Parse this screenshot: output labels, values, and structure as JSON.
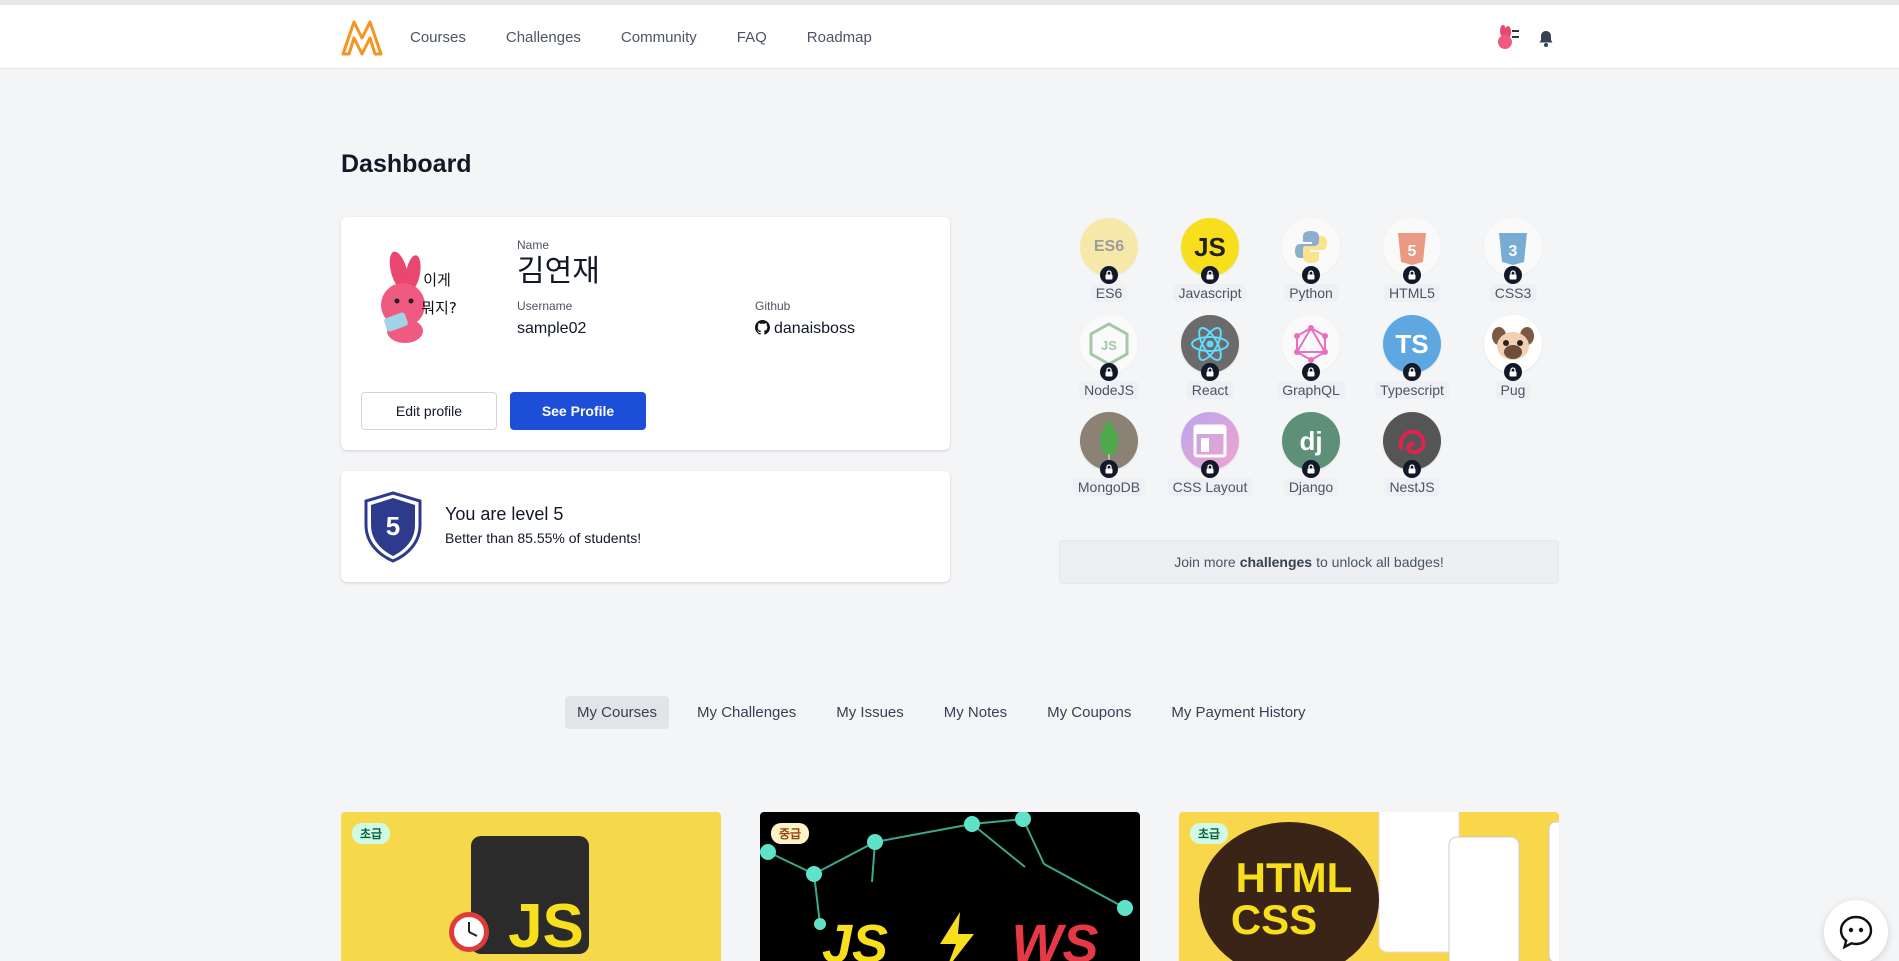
{
  "nav": {
    "links": [
      "Courses",
      "Challenges",
      "Community",
      "FAQ",
      "Roadmap"
    ],
    "brand_color": "#f7931e"
  },
  "dashboard": {
    "title": "Dashboard",
    "profile": {
      "name_label": "Name",
      "name": "김연재",
      "username_label": "Username",
      "username": "sample02",
      "github_label": "Github",
      "github": "danaisboss",
      "edit_button": "Edit profile",
      "see_button": "See Profile",
      "avatar_text_line1": "이게",
      "avatar_text_line2": "뭐지?"
    },
    "level": {
      "number": "5",
      "title": "You are level 5",
      "subtitle": "Better than 85.55% of students!"
    }
  },
  "badges": {
    "items": [
      {
        "label": "ES6",
        "icon": "es6-icon",
        "glyph": "ES6"
      },
      {
        "label": "Javascript",
        "icon": "javascript-icon",
        "glyph": "JS"
      },
      {
        "label": "Python",
        "icon": "python-icon",
        "glyph": ""
      },
      {
        "label": "HTML5",
        "icon": "html5-icon",
        "glyph": "5"
      },
      {
        "label": "CSS3",
        "icon": "css3-icon",
        "glyph": "3"
      },
      {
        "label": "NodeJS",
        "icon": "nodejs-icon",
        "glyph": "JS"
      },
      {
        "label": "React",
        "icon": "react-icon",
        "glyph": ""
      },
      {
        "label": "GraphQL",
        "icon": "graphql-icon",
        "glyph": ""
      },
      {
        "label": "Typescript",
        "icon": "typescript-icon",
        "glyph": "TS"
      },
      {
        "label": "Pug",
        "icon": "pug-icon",
        "glyph": ""
      },
      {
        "label": "MongoDB",
        "icon": "mongodb-icon",
        "glyph": ""
      },
      {
        "label": "CSS Layout",
        "icon": "css-layout-icon",
        "glyph": ""
      },
      {
        "label": "Django",
        "icon": "django-icon",
        "glyph": "dj"
      },
      {
        "label": "NestJS",
        "icon": "nestjs-icon",
        "glyph": ""
      }
    ],
    "unlock_prefix": "Join more",
    "unlock_bold": "challenges",
    "unlock_suffix": "to unlock all badges!"
  },
  "tabs": [
    "My Courses",
    "My Challenges",
    "My Issues",
    "My Notes",
    "My Coupons",
    "My Payment History"
  ],
  "courses": [
    {
      "level": "초급",
      "art_text": "JS"
    },
    {
      "level": "중급",
      "art_text_left": "JS",
      "art_text_right": "WS"
    },
    {
      "level": "초급",
      "art_text_line1": "HTML",
      "art_text_line2": "CSS"
    }
  ]
}
